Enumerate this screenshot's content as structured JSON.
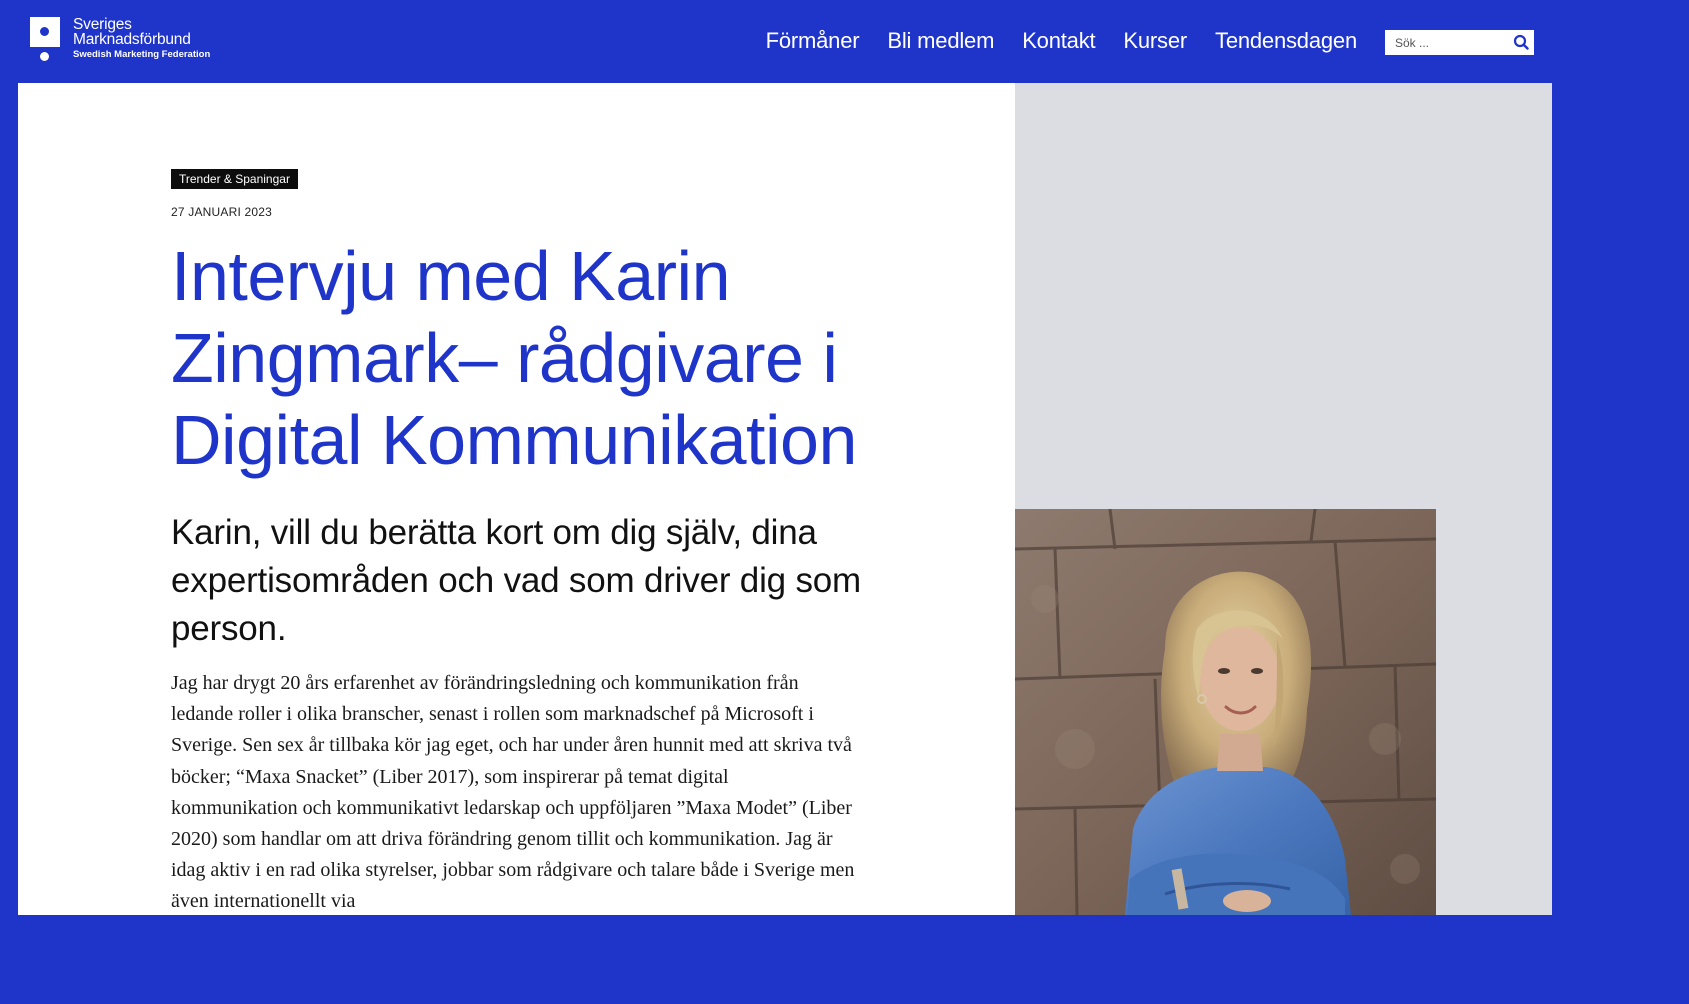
{
  "brand": {
    "line1": "Sveriges",
    "line2": "Marknadsförbund",
    "line3": "Swedish Marketing Federation"
  },
  "nav": {
    "items": [
      {
        "label": "Förmåner"
      },
      {
        "label": "Bli medlem"
      },
      {
        "label": "Kontakt"
      },
      {
        "label": "Kurser"
      },
      {
        "label": "Tendensdagen"
      }
    ]
  },
  "search": {
    "placeholder": "Sök ...",
    "value": ""
  },
  "article": {
    "category": "Trender & Spaningar",
    "date": "27 JANUARI 2023",
    "title": "Intervju med Karin Zingmark– rådgivare i Digital Kommunikation",
    "question": "Karin, vill du berätta kort om dig själv, dina expertisområden och vad som driver dig som person.",
    "body": "Jag har drygt 20 års erfarenhet av förändringsledning och kommunikation från ledande roller i olika branscher, senast i rollen som marknadschef på Microsoft i Sverige. Sen sex år tillbaka kör jag eget, och har under åren hunnit med att skriva två böcker; “Maxa Snacket” (Liber 2017), som inspirerar på temat digital kommunikation och kommunikativt ledarskap och uppföljaren ”Maxa Modet” (Liber 2020) som handlar om att driva förändring genom tillit och kommunikation. Jag är idag aktiv i en rad olika styrelser, jobbar som rådgivare och talare både i Sverige men även internationellt via"
  },
  "colors": {
    "brand_blue": "#1f35c9",
    "aside_gray": "#dcdde2",
    "tag_black": "#0d0d0d"
  }
}
